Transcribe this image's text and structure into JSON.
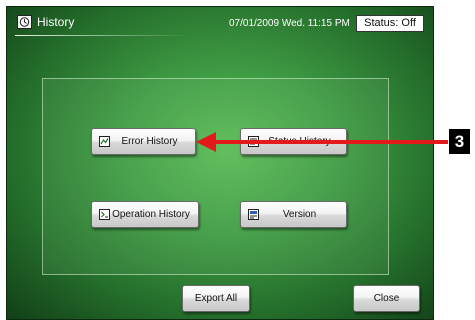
{
  "header": {
    "title": "History",
    "datetime": "07/01/2009 Wed. 11:15 PM",
    "status": "Status: Off"
  },
  "buttons": {
    "error_history": "Error History",
    "status_history": "Status History",
    "operation_history": "Operation History",
    "version": "Version",
    "export_all": "Export All",
    "close": "Close"
  },
  "callout": {
    "step": "3"
  },
  "colors": {
    "arrow": "#e41a1a",
    "screen_green": "#3f9b43"
  },
  "icons": {
    "title": "history-icon",
    "error_history": "error-history-icon",
    "status_history": "status-history-icon",
    "operation_history": "operation-history-icon",
    "version": "version-icon"
  }
}
